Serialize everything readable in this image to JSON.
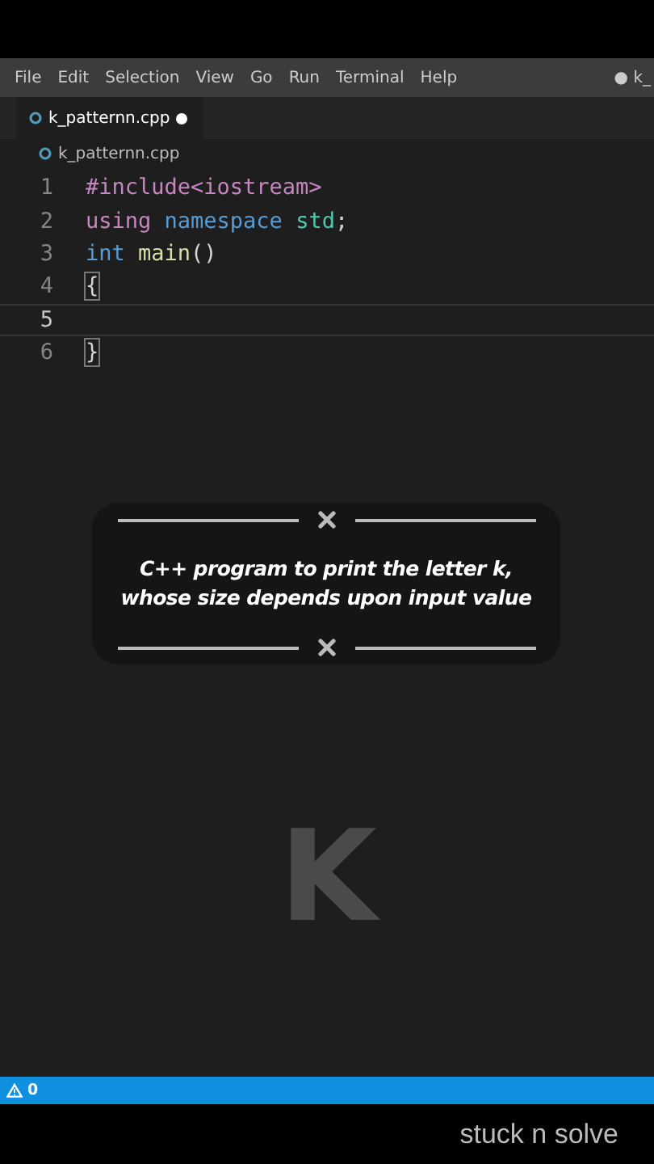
{
  "menu": [
    "File",
    "Edit",
    "Selection",
    "View",
    "Go",
    "Run",
    "Terminal",
    "Help"
  ],
  "window_title": "● k_",
  "tabs": [
    {
      "label": "k_patternn.cpp",
      "selected": true,
      "modified": true
    }
  ],
  "breadcrumb": "k_patternn.cpp",
  "code_lines": [
    {
      "number": "1",
      "current": false,
      "tokens": [
        {
          "text": "#include<iostream>",
          "kind": "directive"
        }
      ]
    },
    {
      "number": "2",
      "current": false,
      "tokens": [
        {
          "text": "using ",
          "kind": "keyword"
        },
        {
          "text": "namespace ",
          "kind": "type"
        },
        {
          "text": "std",
          "kind": "namespace"
        },
        {
          "text": ";",
          "kind": "plain"
        }
      ]
    },
    {
      "number": "3",
      "current": false,
      "tokens": [
        {
          "text": "int ",
          "kind": "type"
        },
        {
          "text": "main",
          "kind": "function"
        },
        {
          "text": "()",
          "kind": "plain"
        }
      ]
    },
    {
      "number": "4",
      "current": false,
      "tokens": [
        {
          "text": "{",
          "kind": "bracket"
        }
      ]
    },
    {
      "number": "5",
      "current": true
    },
    {
      "number": "6",
      "current": false,
      "tokens": [
        {
          "text": "}",
          "kind": "bracket"
        }
      ]
    }
  ],
  "caption": "C++ program to print the letter k, whose size depends upon input value",
  "overlay_letter": "K",
  "status_bar": {
    "warnings": "0"
  },
  "channel_name": "stuck n solve"
}
